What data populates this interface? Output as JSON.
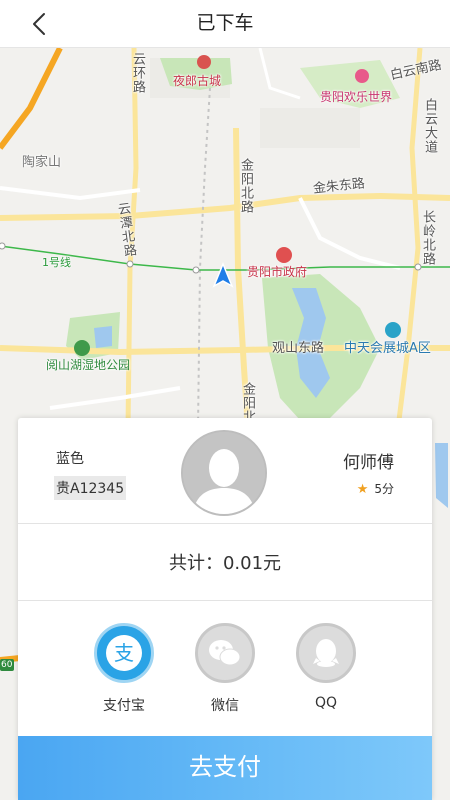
{
  "header": {
    "title": "已下车"
  },
  "map": {
    "labels": {
      "yunhuan": "云环路",
      "yelang": "夜郎古城",
      "baiyun_south": "白云南路",
      "huanle": "贵阳欢乐世界",
      "baiyun_da": "白云大道",
      "taojia": "陶家山",
      "jinyang_north_top": "金阳北路",
      "jinzhu_east": "金朱东路",
      "yuntan_north": "云潭北路",
      "changling_north": "长岭北路",
      "line1": "1号线",
      "gov": "贵阳市政府",
      "yueshan": "阅山湖湿地公园",
      "guanshan_east": "观山东路",
      "zhongtian": "中天会展城A区",
      "jinyang_north_bottom": "金阳北"
    },
    "road_number": "60"
  },
  "driver": {
    "car_color": "蓝色",
    "plate": "贵A12345",
    "name": "何师傅",
    "rating_star": "★",
    "rating": "5分"
  },
  "fare": {
    "total_text": "共计：0.01元"
  },
  "payment_methods": [
    {
      "label": "支付宝",
      "icon": "alipay-icon",
      "selected": true
    },
    {
      "label": "微信",
      "icon": "wechat-icon",
      "selected": false
    },
    {
      "label": "QQ",
      "icon": "qq-icon",
      "selected": false
    }
  ],
  "actions": {
    "pay_label": "去支付"
  },
  "colors": {
    "accent": "#2aa3e6",
    "button": "#5ab2f4",
    "star": "#f0a020",
    "park": "#c8e6b8",
    "metro": "#3db84a"
  }
}
